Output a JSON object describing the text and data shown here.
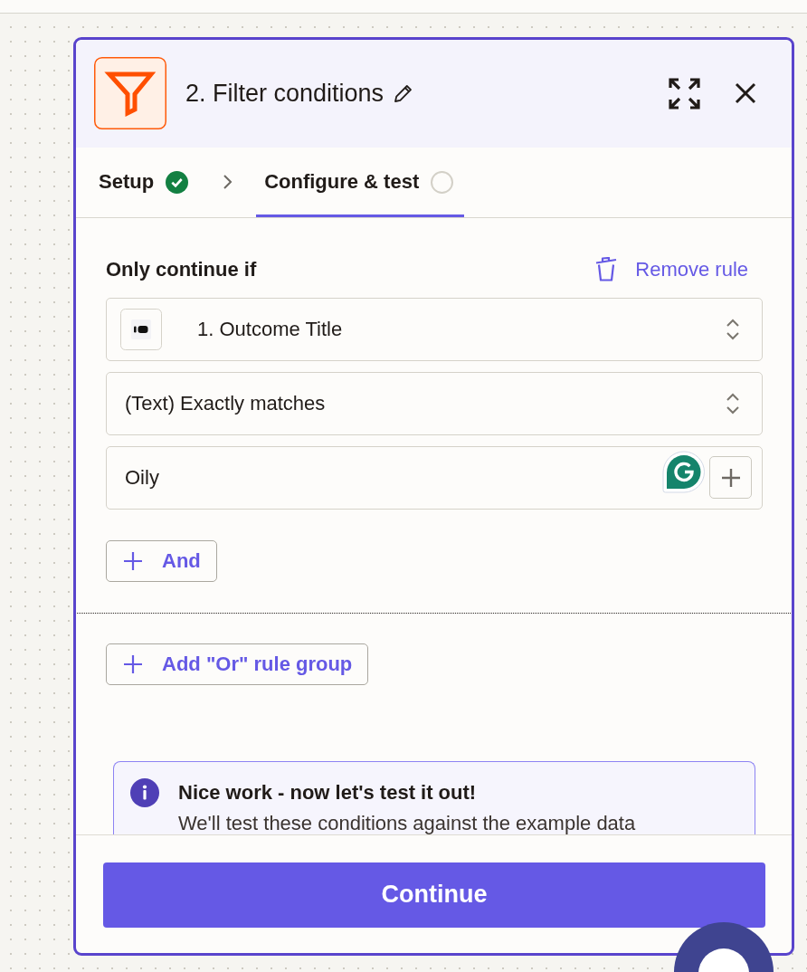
{
  "header": {
    "title": "2. Filter conditions"
  },
  "tabs": [
    {
      "label": "Setup",
      "selected": false,
      "done": true
    },
    {
      "label": "Configure & test",
      "selected": true,
      "done": false
    }
  ],
  "rule_group": {
    "heading": "Only continue if",
    "remove_label": "Remove rule",
    "fields": [
      {
        "kind": "select",
        "value": "1. Outcome Title",
        "has_app_icon": true
      },
      {
        "kind": "select",
        "value": "(Text) Exactly matches",
        "has_app_icon": false
      },
      {
        "kind": "text",
        "value": "Oily",
        "has_app_icon": false
      }
    ],
    "and_label": "And"
  },
  "or_label": "Add \"Or\" rule group",
  "notice": {
    "title": "Nice work - now let's test it out!",
    "body": "We'll test these conditions against the example data"
  },
  "continue_label": "Continue"
}
